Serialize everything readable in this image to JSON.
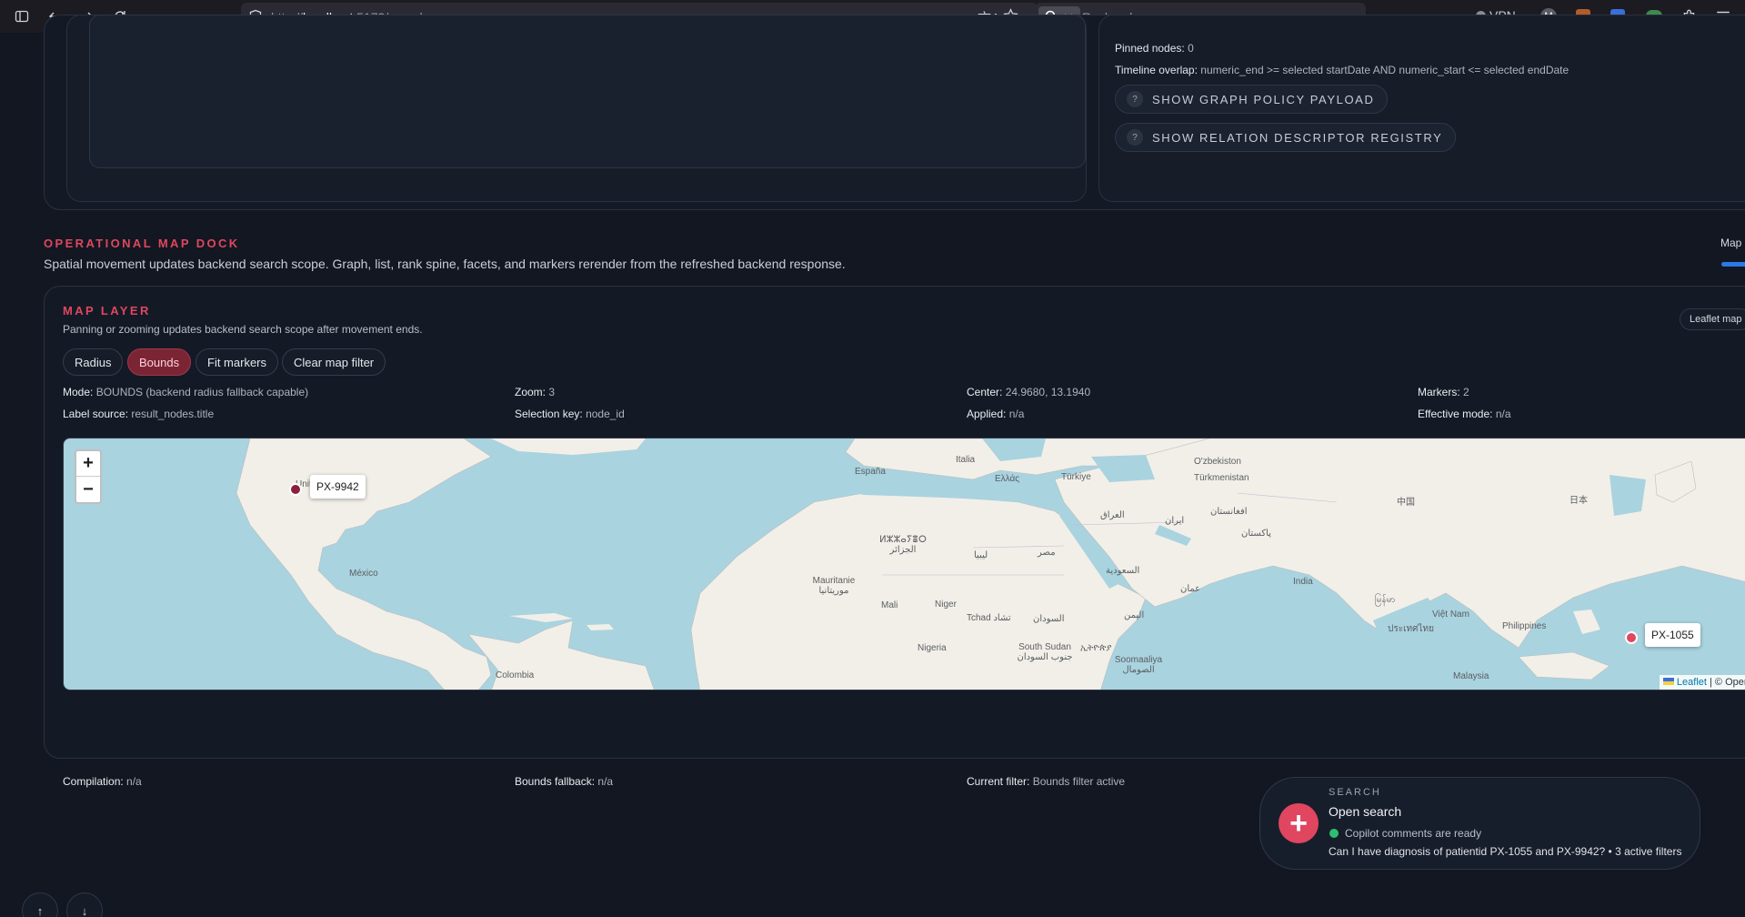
{
  "browser": {
    "url_prefix": "http://",
    "url_host": "localhost",
    "url_path": ":5173/search",
    "search_placeholder": "Rechercher",
    "vpn_label": "VPN"
  },
  "top_panel": {
    "pinned_label": "Pinned nodes:",
    "pinned_value": "0",
    "timeline_label": "Timeline overlap:",
    "timeline_value": "numeric_end >= selected startDate AND numeric_start <= selected endDate",
    "policy_button": "SHOW GRAPH POLICY PAYLOAD",
    "registry_button": "SHOW RELATION DESCRIPTOR REGISTRY",
    "help_glyph": "?"
  },
  "dock": {
    "title": "OPERATIONAL MAP DOCK",
    "description": "Spatial movement updates backend search scope. Graph, list, rank spine, facets, and markers rerender from the refreshed backend response.",
    "tab_label": "Map"
  },
  "map_layer": {
    "title": "MAP LAYER",
    "description": "Panning or zooming updates backend search scope after movement ends.",
    "badge": "Leaflet map",
    "buttons": [
      "Radius",
      "Bounds",
      "Fit markers",
      "Clear map filter"
    ],
    "active_button": "Bounds",
    "stats": {
      "mode_label": "Mode:",
      "mode_value": "BOUNDS (backend radius fallback capable)",
      "zoom_label": "Zoom:",
      "zoom_value": "3",
      "center_label": "Center:",
      "center_value": "24.9680, 13.1940",
      "markers_label": "Markers:",
      "markers_value": "2",
      "label_source_label": "Label source:",
      "label_source_value": "result_nodes.title",
      "selection_key_label": "Selection key:",
      "selection_key_value": "node_id",
      "applied_label": "Applied:",
      "applied_value": "n/a",
      "effective_mode_label": "Effective mode:",
      "effective_mode_value": "n/a"
    },
    "zoom_in": "+",
    "zoom_out": "−",
    "markers": [
      {
        "label": "PX-9942",
        "color": "#8e1f3a"
      },
      {
        "label": "PX-1055",
        "color": "#e0465f"
      }
    ],
    "places": [
      "España",
      "Italia",
      "Ελλάς",
      "Türkiye",
      "O'zbekiston",
      "Türkmenistan",
      "United States",
      "México",
      "ⵍⵣⵣⴰⵢⴻⵔ الجزائر",
      "ليبيا",
      "مصر",
      "العراق",
      "ایران",
      "افغانستان",
      "پاکستان",
      "中国",
      "日本",
      "Mauritanie موريتانيا",
      "Mali",
      "Niger",
      "Tchad تشاد",
      "السودان",
      "السعودية",
      "عمان",
      "India",
      "မြန်မာ",
      "Việt Nam",
      "ประเทศไทย",
      "Philippines",
      "اليمن",
      "Nigeria",
      "South Sudan جنوب السودان",
      "ኢትዮጵያ",
      "Soomaaliya الصومال",
      "Colombia",
      "Malaysia"
    ],
    "attribution_link": "Leaflet",
    "attribution_rest": "| © Open",
    "footer": {
      "compilation_label": "Compilation:",
      "compilation_value": "n/a",
      "bounds_fallback_label": "Bounds fallback:",
      "bounds_fallback_value": "n/a",
      "current_filter_label": "Current filter:",
      "current_filter_value": "Bounds filter active"
    }
  },
  "search_panel": {
    "kicker": "SEARCH",
    "title": "Open search",
    "status": "Copilot comments are ready",
    "query": "Can I have diagnosis of patientid PX-1055 and PX-9942? • 3 active filters",
    "icon_glyph": "+"
  },
  "scroll": {
    "up": "↑",
    "down": "↓"
  },
  "colors": {
    "accent": "#e0465f",
    "tab_indicator": "#2a79e8",
    "status_ok": "#2fbf71"
  }
}
